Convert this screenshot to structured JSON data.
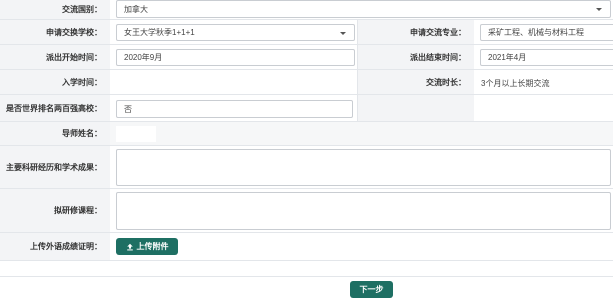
{
  "rows": {
    "country": {
      "label": "交流国别：",
      "value": "加拿大"
    },
    "school": {
      "label": "申请交换学校：",
      "value": "女王大学秋季1+1+1"
    },
    "major": {
      "label": "申请交流专业：",
      "value": "采矿工程、机械与材料工程"
    },
    "start": {
      "label": "派出开始时间：",
      "value": "2020年9月"
    },
    "end": {
      "label": "派出结束时间：",
      "value": "2021年4月"
    },
    "entry": {
      "label": "入学时间：",
      "value": ""
    },
    "duration": {
      "label": "交流时长：",
      "value": "3个月以上长期交流"
    },
    "top200": {
      "label": "是否世界排名两百强高校：",
      "value": "否"
    },
    "mentor": {
      "label": "导师姓名：",
      "value": ""
    },
    "research": {
      "label": "主要科研经历和学术成果：",
      "value": ""
    },
    "courses": {
      "label": "拟研修课程：",
      "value": ""
    },
    "language": {
      "label": "上传外语成绩证明：",
      "button": "上传附件"
    }
  },
  "footer": {
    "next_label": "下一步"
  },
  "icons": {
    "upload": "upload-icon",
    "dropdown": "chevron-down-icon"
  },
  "colors": {
    "primary": "#1e6f63",
    "label_bg": "#f3f4f6",
    "border": "#c9cdd2"
  }
}
